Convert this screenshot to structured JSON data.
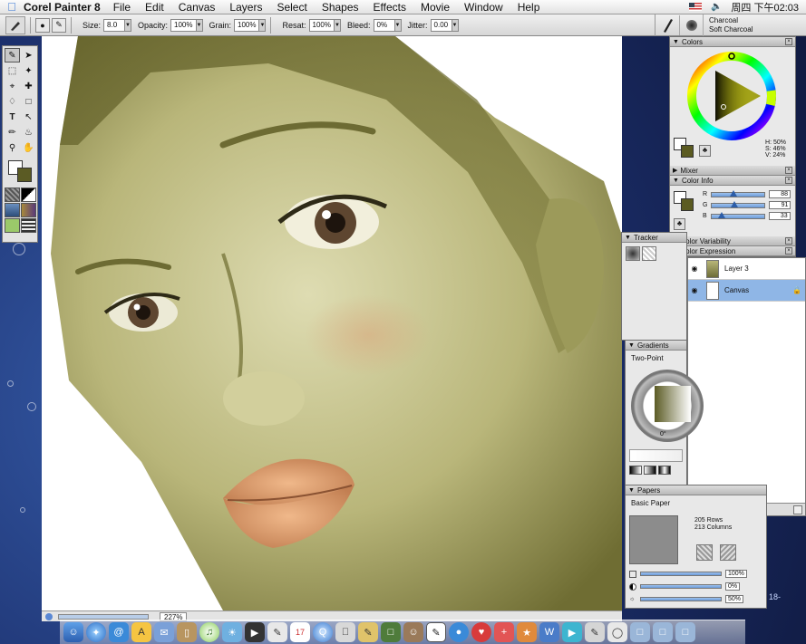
{
  "menubar": {
    "app_name": "Corel Painter 8",
    "menus": [
      "File",
      "Edit",
      "Canvas",
      "Layers",
      "Select",
      "Shapes",
      "Effects",
      "Movie",
      "Window",
      "Help"
    ],
    "clock": "周四 下午02:03"
  },
  "propbar": {
    "size_label": "Size:",
    "size_value": "8.0",
    "opacity_label": "Opacity:",
    "opacity_value": "100%",
    "grain_label": "Grain:",
    "grain_value": "100%",
    "resat_label": "Resat:",
    "resat_value": "100%",
    "bleed_label": "Bleed:",
    "bleed_value": "0%",
    "jitter_label": "Jitter:",
    "jitter_value": "0.00",
    "brush_category": "Charcoal",
    "brush_variant": "Soft Charcoal"
  },
  "colors_panel": {
    "title": "Colors",
    "h": "H: 50%",
    "s": "S: 46%",
    "v": "V: 24%",
    "accent_color": "#5b5b21"
  },
  "mixer_panel": {
    "title": "Mixer"
  },
  "color_info": {
    "title": "Color Info",
    "r_label": "R",
    "r_value": "88",
    "g_label": "G",
    "g_value": "91",
    "b_label": "B",
    "b_value": "33"
  },
  "color_variability": {
    "title": "Color Variability"
  },
  "color_expression": {
    "title": "Color Expression"
  },
  "tracker": {
    "title": "Tracker"
  },
  "layers": {
    "rows": [
      {
        "name": "Layer 3",
        "selected": false
      },
      {
        "name": "Canvas",
        "selected": true
      }
    ]
  },
  "gradients": {
    "title": "Gradients",
    "type": "Two-Point",
    "angle": "0°"
  },
  "papers": {
    "title": "Papers",
    "name": "Basic Paper",
    "rows": "205 Rows",
    "columns": "213 Columns",
    "scale": "100%",
    "contrast": "0%",
    "brightness": "50%"
  },
  "canvas_window": {
    "zoom": "227%"
  },
  "desktop": {
    "edge_text": "18-"
  }
}
